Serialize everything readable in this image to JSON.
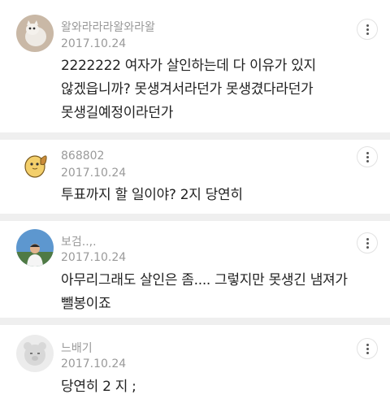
{
  "comments": [
    {
      "username": "왈와라라라왈와라왈",
      "date": "2017.10.24",
      "lines": [
        "2222222 여자가 살인하는데 다 이유가 있지",
        "않겠읍니까? 못생겨서라던가 못생겼다라던가",
        "못생길예정이라던가"
      ],
      "avatar": "cat-avatar"
    },
    {
      "username": "868802",
      "date": "2017.10.24",
      "lines": [
        "투표까지 할 일이야? 2지 당연히"
      ],
      "avatar": "chick-avatar"
    },
    {
      "username": "보검..,.",
      "date": "2017.10.24",
      "lines": [
        "아무리그래도 살인은 좀.... 그렇지만 못생긴 냄져가",
        "뺄봉이죠"
      ],
      "avatar": "person-avatar"
    },
    {
      "username": "느배기",
      "date": "2017.10.24",
      "lines": [
        "당연히 2 지 ;"
      ],
      "avatar": "bear-avatar"
    }
  ],
  "colors": {
    "meta": "#9a9a9a",
    "text": "#222222",
    "separator": "#efefef"
  }
}
